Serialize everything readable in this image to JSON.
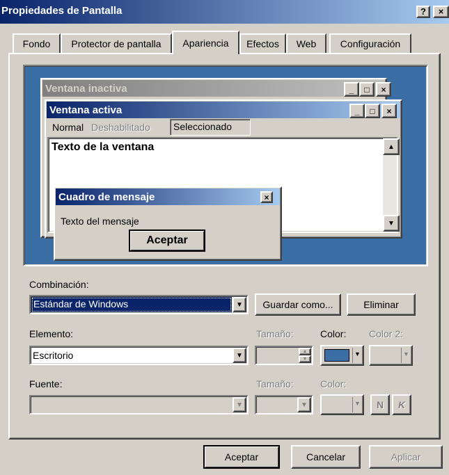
{
  "window": {
    "title": "Propiedades de Pantalla",
    "help": "?",
    "close": "×"
  },
  "tabs": [
    {
      "label": "Fondo"
    },
    {
      "label": "Protector de pantalla"
    },
    {
      "label": "Apariencia"
    },
    {
      "label": "Efectos"
    },
    {
      "label": "Web"
    },
    {
      "label": "Configuración"
    }
  ],
  "preview": {
    "inactive_title": "Ventana inactiva",
    "active_title": "Ventana activa",
    "menu": {
      "normal": "Normal",
      "disabled": "Deshabilitado",
      "selected": "Seleccionado"
    },
    "window_text": "Texto de la ventana",
    "msgbox_title": "Cuadro de mensaje",
    "msgbox_text": "Texto del mensaje",
    "msgbox_button": "Aceptar"
  },
  "scheme": {
    "label": "Combinación:",
    "value": "Estándar de Windows",
    "save_as": "Guardar como...",
    "delete": "Eliminar"
  },
  "item": {
    "label": "Elemento:",
    "value": "Escritorio",
    "size_label": "Tamaño:",
    "color_label": "Color:",
    "color2_label": "Color 2:",
    "color_value": "#3a6ea5"
  },
  "font": {
    "label": "Fuente:",
    "size_label": "Tamaño:",
    "color_label": "Color:",
    "bold": "N",
    "italic": "K"
  },
  "footer": {
    "ok": "Aceptar",
    "cancel": "Cancelar",
    "apply": "Aplicar"
  },
  "colors": {
    "titlebar": "#0a246a",
    "desktop": "#3a6ea5",
    "inactive": "#808080",
    "face": "#d4d0c8"
  }
}
